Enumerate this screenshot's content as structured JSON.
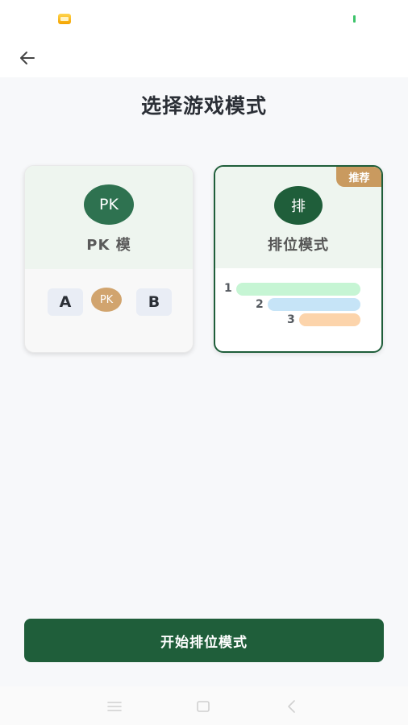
{
  "header": {
    "title": "选择游戏模式"
  },
  "modes": {
    "pk": {
      "icon_text": "PK",
      "label": "PK 模",
      "team_a": "A",
      "vs": "PK",
      "team_b": "B"
    },
    "rank": {
      "icon_text": "排",
      "label": "排位模式",
      "badge": "推荐",
      "ranks": [
        "1",
        "2",
        "3"
      ],
      "bar_colors": [
        "#c6f5d4",
        "#c6e4f7",
        "#fcd4ab"
      ]
    }
  },
  "start_button": {
    "label": "开始排位模式"
  },
  "colors": {
    "primary": "#1f5e3a",
    "accent": "#c99a5f"
  },
  "icons": {
    "back": "arrow-left-icon",
    "nav": [
      "menu-icon",
      "home-square-icon",
      "back-chevron-icon"
    ]
  }
}
